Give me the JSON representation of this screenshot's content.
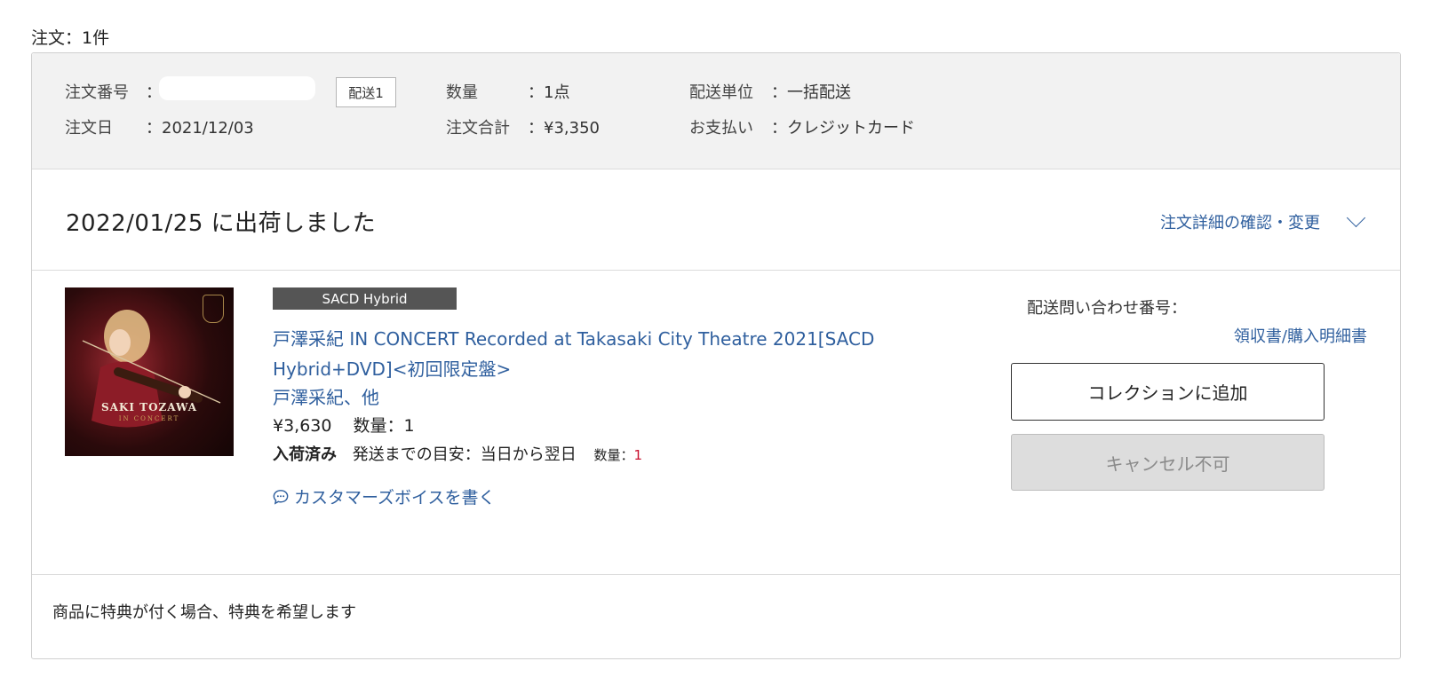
{
  "order_count_label": "注文：1件",
  "summary": {
    "order_number_label": "注文番号",
    "order_number_sep": "：",
    "shipment_tag": "配送1",
    "order_date_label": "注文日",
    "order_date_value": "：2021/12/03",
    "quantity_label": "数量",
    "quantity_value": "：1点",
    "total_label": "注文合計",
    "total_value": "：¥3,350",
    "delivery_unit_label": "配送単位",
    "delivery_unit_value": "：一括配送",
    "payment_label": "お支払い",
    "payment_value": "：クレジットカード"
  },
  "shipment": {
    "date": "2022/01/25",
    "status_suffix": "に出荷しました",
    "detail_link": "注文詳細の確認・変更"
  },
  "product": {
    "format_badge": "SACD Hybrid",
    "title_line1": "戸澤采紀 IN CONCERT Recorded at Takasaki City Theatre 2021[SACD",
    "title_line2": "Hybrid+DVD]<初回限定盤>",
    "artist": "戸澤采紀、他",
    "price": "¥3,630",
    "quantity": "数量：1",
    "stock_status": "入荷済み",
    "ship_estimate": "発送までの目安：当日から翌日",
    "stock_qty_label": "数量：",
    "stock_qty_value": "1",
    "voice_link": "カスタマーズボイスを書く",
    "cover_title": "SAKI TOZAWA",
    "cover_subtitle": "IN CONCERT"
  },
  "actions": {
    "tracking_label": "配送問い合わせ番号：",
    "receipt_link": "領収書/購入明細書",
    "collection_button": "コレクションに追加",
    "cancel_button": "キャンセル不可"
  },
  "footer": {
    "bonus_note": "商品に特典が付く場合、特典を希望します"
  },
  "colors": {
    "link": "#2f5f9e",
    "summary_bg": "#f2f2f2",
    "badge_bg": "#555555",
    "qty_red": "#c8102e"
  }
}
